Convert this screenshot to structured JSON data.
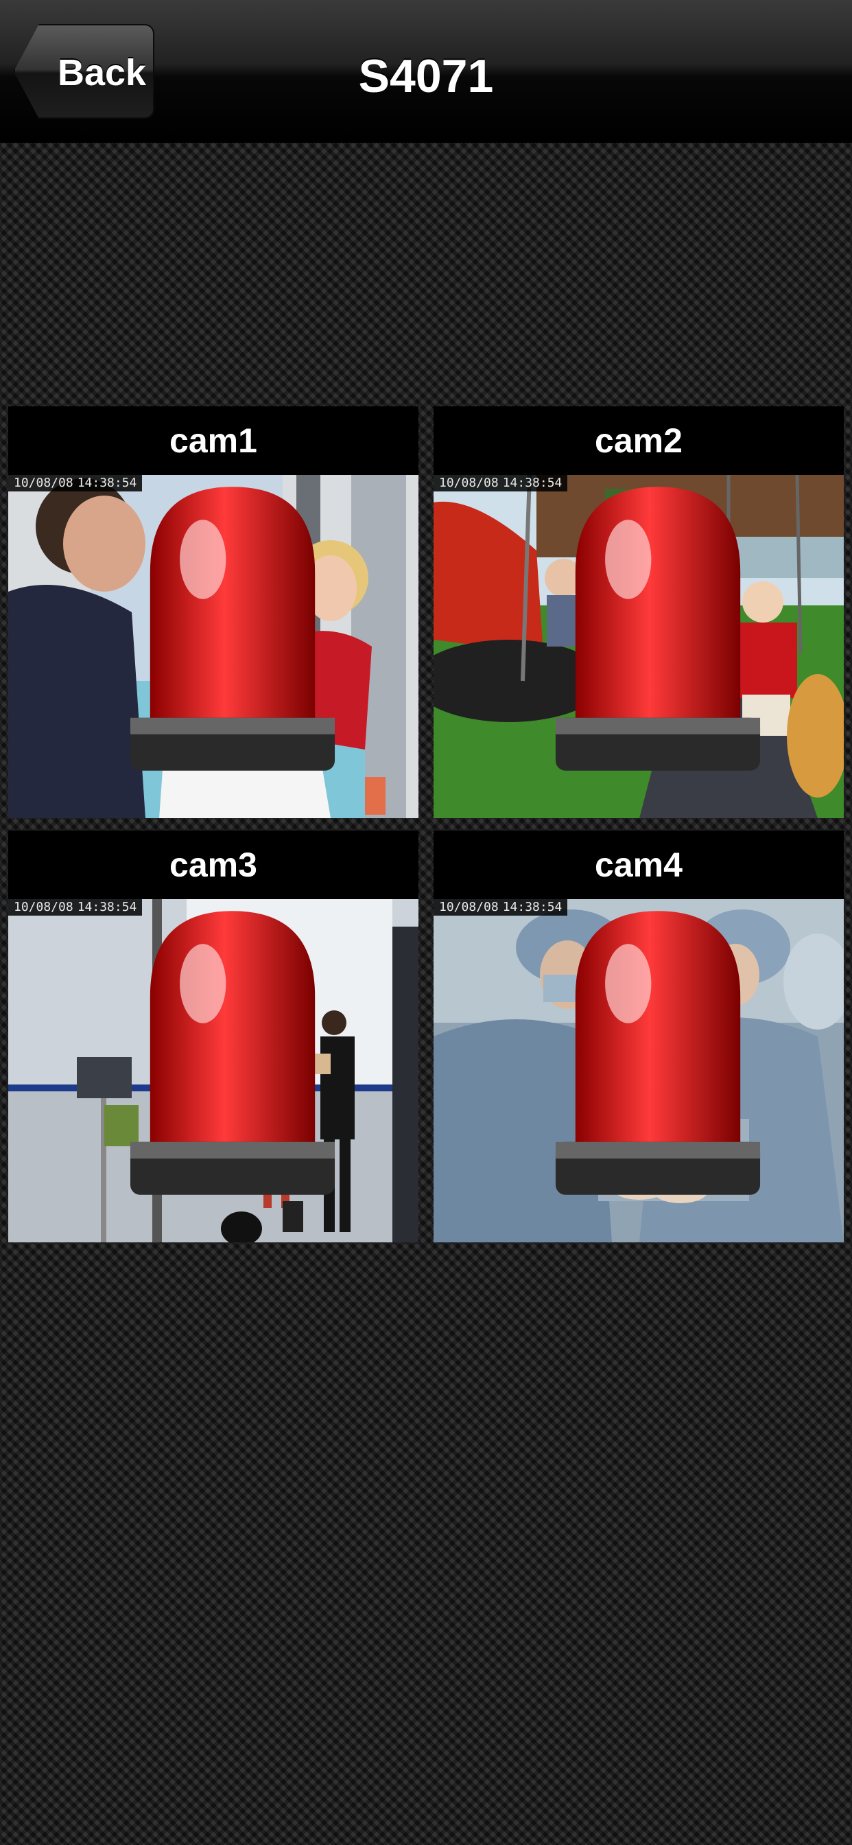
{
  "header": {
    "back_label": "Back",
    "title": "S4071"
  },
  "cameras": [
    {
      "label": "cam1",
      "osd_date": "10/08/08",
      "osd_time": "14:38:54",
      "alarm_icon": "alarm-siren-icon",
      "scene": "living-room"
    },
    {
      "label": "cam2",
      "osd_date": "10/08/08",
      "osd_time": "14:38:54",
      "alarm_icon": "alarm-siren-icon",
      "scene": "playground"
    },
    {
      "label": "cam3",
      "osd_date": "10/08/08",
      "osd_time": "14:38:54",
      "alarm_icon": "alarm-siren-icon",
      "scene": "office-lobby"
    },
    {
      "label": "cam4",
      "osd_date": "10/08/08",
      "osd_time": "14:38:54",
      "alarm_icon": "alarm-siren-icon",
      "scene": "operating-room"
    }
  ],
  "colors": {
    "alarm_red": "#e01010",
    "header_bg": "#000000",
    "text": "#ffffff"
  }
}
